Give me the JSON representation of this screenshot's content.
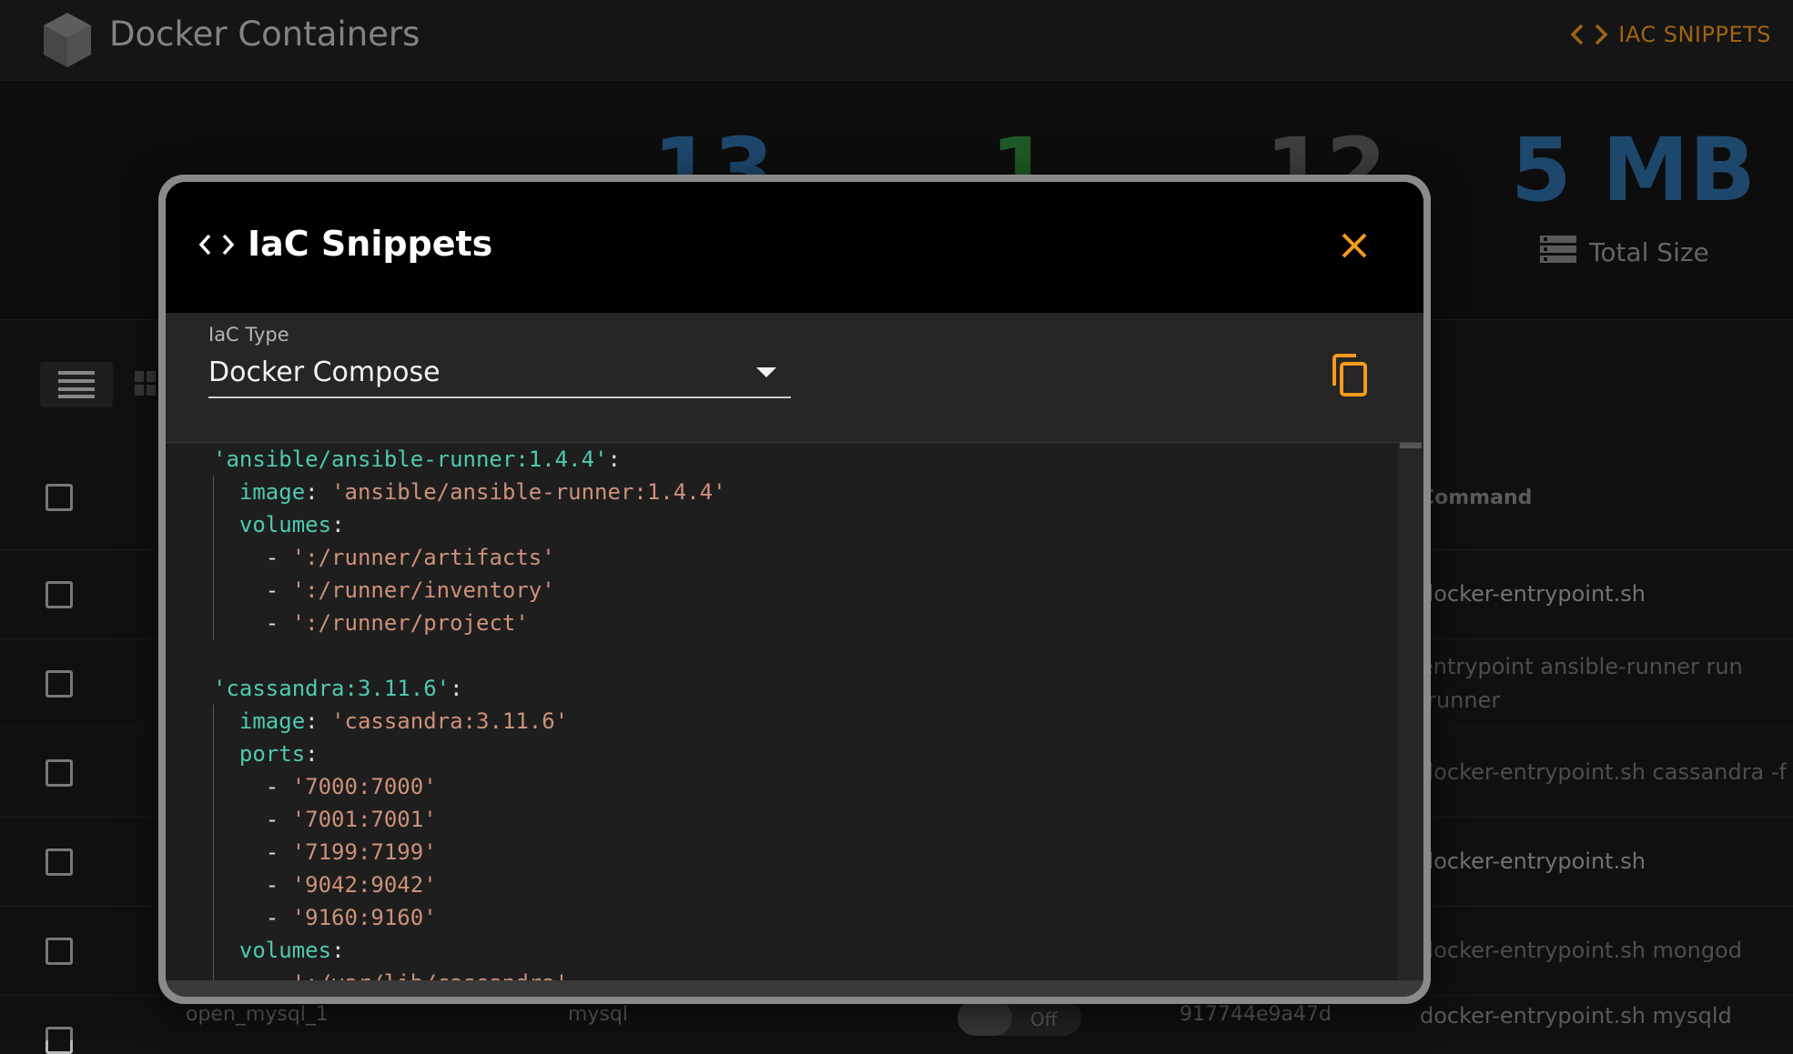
{
  "app": {
    "title": "Docker Containers",
    "iac_link_label": "IAC SNIPPETS"
  },
  "stats": {
    "total": "13",
    "running": "1",
    "stopped": "12",
    "size": "5 MB",
    "size_label": "Total Size"
  },
  "table": {
    "header_command": "Command",
    "rows": [
      {
        "command": "docker-entrypoint.sh"
      },
      {
        "command_line1": "entrypoint ansible-runner run",
        "command_line2": "/runner"
      },
      {
        "command": "docker-entrypoint.sh cassandra -f"
      },
      {
        "command": "docker-entrypoint.sh"
      },
      {
        "command": "docker-entrypoint.sh mongod"
      }
    ],
    "last_row": {
      "name": "open_mysql_1",
      "image": "mysql",
      "toggle": "Off",
      "id": "917744e9a47d",
      "command": "docker-entrypoint.sh mysqld"
    }
  },
  "dialog": {
    "title": "IaC Snippets",
    "field_label": "IaC Type",
    "selected_type": "Docker Compose"
  },
  "code_lines": [
    {
      "indent": 0,
      "key": "'ansible/ansible-runner:1.4.4'",
      "rest": ":"
    },
    {
      "indent": 1,
      "key": "image",
      "sep": ": ",
      "val": "'ansible/ansible-runner:1.4.4'"
    },
    {
      "indent": 1,
      "key": "volumes",
      "rest": ":"
    },
    {
      "indent": 2,
      "dash": "- ",
      "val": "':/runner/artifacts'"
    },
    {
      "indent": 2,
      "dash": "- ",
      "val": "':/runner/inventory'"
    },
    {
      "indent": 2,
      "dash": "- ",
      "val": "':/runner/project'"
    },
    {
      "blank": true
    },
    {
      "indent": 0,
      "key": "'cassandra:3.11.6'",
      "rest": ":"
    },
    {
      "indent": 1,
      "key": "image",
      "sep": ": ",
      "val": "'cassandra:3.11.6'"
    },
    {
      "indent": 1,
      "key": "ports",
      "rest": ":"
    },
    {
      "indent": 2,
      "dash": "- ",
      "val": "'7000:7000'"
    },
    {
      "indent": 2,
      "dash": "- ",
      "val": "'7001:7001'"
    },
    {
      "indent": 2,
      "dash": "- ",
      "val": "'7199:7199'"
    },
    {
      "indent": 2,
      "dash": "- ",
      "val": "'9042:9042'"
    },
    {
      "indent": 2,
      "dash": "- ",
      "val": "'9160:9160'"
    },
    {
      "indent": 1,
      "key": "volumes",
      "rest": ":"
    },
    {
      "indent": 2,
      "dash": "- ",
      "val": "':/var/lib/cassandra'"
    }
  ],
  "colors": {
    "accent": "#f59a1d",
    "blue_stat": "#2e6ea6",
    "green_stat": "#2f8a3a",
    "yaml_key": "#4ec9b0",
    "yaml_string": "#ce9178"
  },
  "icons": [
    "cube-icon",
    "code-icon",
    "database-icon",
    "list-view-icon",
    "grid-view-icon",
    "close-icon",
    "copy-icon",
    "chevron-down-icon"
  ]
}
